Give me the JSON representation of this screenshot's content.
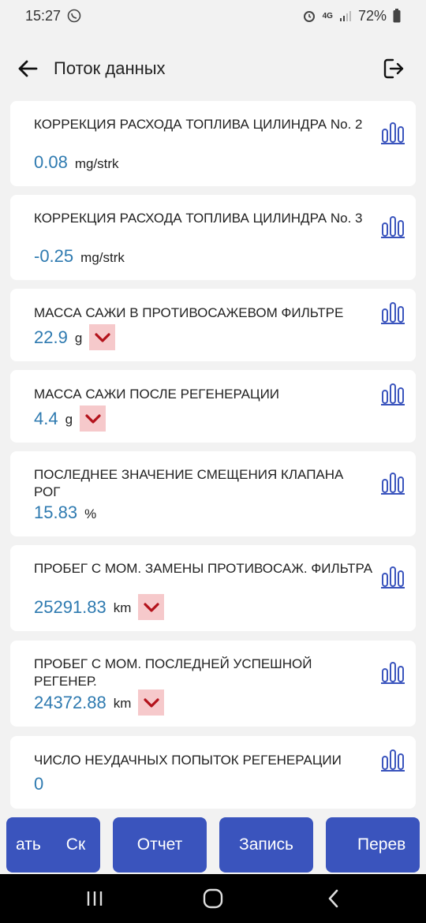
{
  "status_bar": {
    "time": "15:27",
    "network": "4G",
    "battery": "72%"
  },
  "header": {
    "title": "Поток данных"
  },
  "items": [
    {
      "name": "КОРРЕКЦИЯ РАСХОДА ТОПЛИВА ЦИЛИНДРА No. 2",
      "value": "0.08",
      "unit": "mg/strk"
    },
    {
      "name": "КОРРЕКЦИЯ РАСХОДА ТОПЛИВА ЦИЛИНДРА No. 3",
      "value": "-0.25",
      "unit": "mg/strk"
    },
    {
      "name": "МАССА САЖИ В ПРОТИВОСАЖЕВОМ ФИЛЬТРЕ",
      "value": "22.9",
      "unit": "g"
    },
    {
      "name": "МАССА САЖИ ПОСЛЕ РЕГЕНЕРАЦИИ",
      "value": "4.4",
      "unit": "g"
    },
    {
      "name": "ПОСЛЕДНЕЕ ЗНАЧЕНИЕ СМЕЩЕНИЯ КЛАПАНА РОГ",
      "value": "15.83",
      "unit": "%"
    },
    {
      "name": "ПРОБЕГ С МОМ. ЗАМЕНЫ ПРОТИВОСАЖ. ФИЛЬТРА",
      "value": "25291.83",
      "unit": "km"
    },
    {
      "name": "ПРОБЕГ С МОМ. ПОСЛЕДНЕЙ УСПЕШНОЙ РЕГЕНЕР.",
      "value": "24372.88",
      "unit": "km"
    },
    {
      "name": "ЧИСЛО НЕУДАЧНЫХ ПОПЫТОК РЕГЕНЕРАЦИИ",
      "value": "0",
      "unit": ""
    }
  ],
  "bottom_buttons": {
    "first_part_a": "ать",
    "first_part_b": "Ск",
    "report": "Отчет",
    "record": "Запись",
    "next": "Перев"
  },
  "colors": {
    "accent": "#3a54bd",
    "value": "#2e7ab0",
    "dropdown_bg": "#f6c9cb",
    "dropdown_icon": "#b3121b"
  }
}
